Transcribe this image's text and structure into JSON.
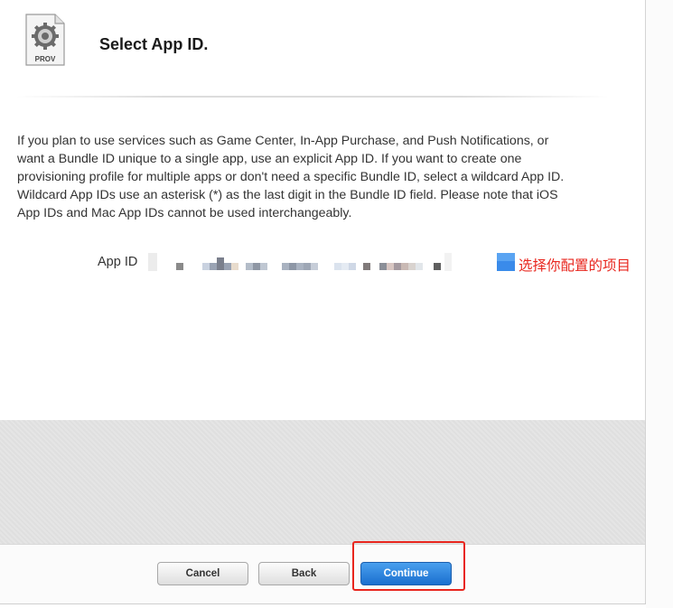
{
  "header": {
    "icon_label": "PROV",
    "title": "Select App ID."
  },
  "description": "If you plan to use services such as Game Center, In-App Purchase, and Push Notifications, or want a Bundle ID unique to a single app, use an explicit App ID. If you want to create one provisioning profile for multiple apps or don't need a specific Bundle ID, select a wildcard App ID. Wildcard App IDs use an asterisk (*) as the last digit in the Bundle ID field. Please note that iOS App IDs and Mac App IDs cannot be used interchangeably.",
  "app_id": {
    "label": "App ID",
    "selected_value_redacted": true,
    "annotation": "选择你配置的项目"
  },
  "buttons": {
    "cancel": "Cancel",
    "back": "Back",
    "continue": "Continue"
  },
  "colors": {
    "annotation_red": "#e8261e",
    "primary_blue": "#1a6fcf"
  }
}
